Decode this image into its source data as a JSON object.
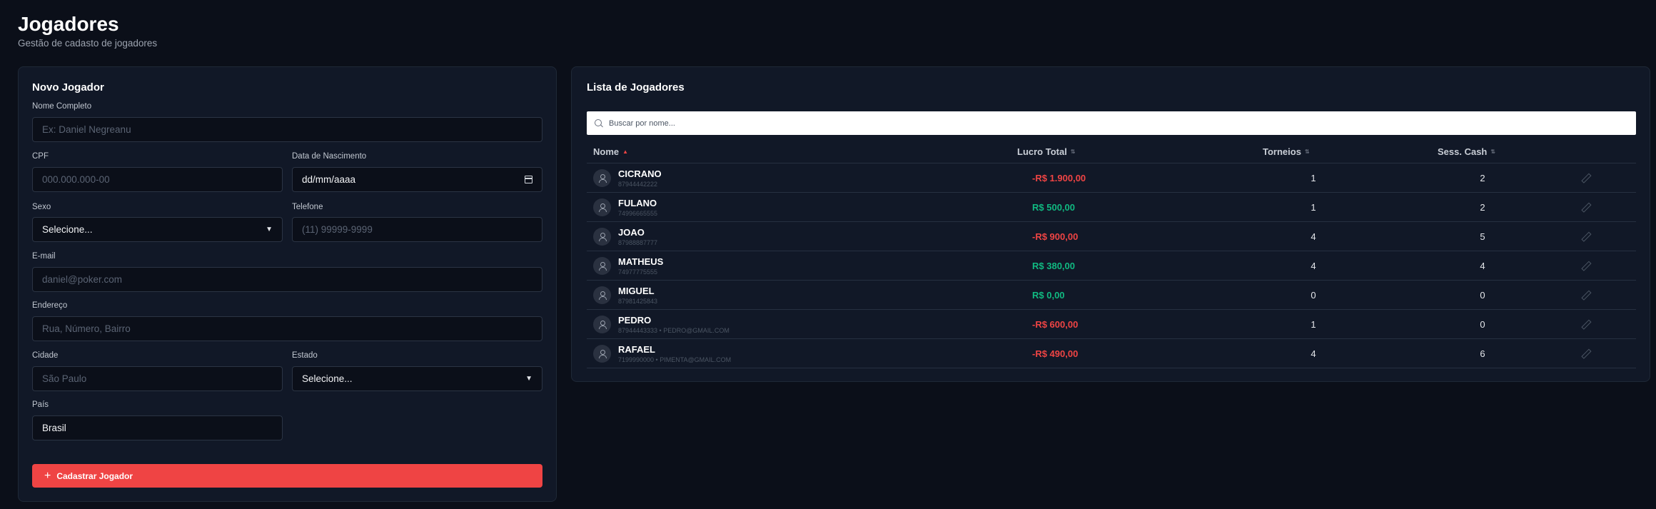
{
  "page": {
    "title": "Jogadores",
    "subtitle": "Gestão de cadasto de jogadores"
  },
  "form": {
    "title": "Novo Jogador",
    "fields": {
      "nome": {
        "label": "Nome Completo",
        "placeholder": "Ex: Daniel Negreanu",
        "value": ""
      },
      "cpf": {
        "label": "CPF",
        "placeholder": "000.000.000-00",
        "value": ""
      },
      "nascimento": {
        "label": "Data de Nascimento",
        "value": "dd/mm/aaaa"
      },
      "sexo": {
        "label": "Sexo",
        "value": "Selecione..."
      },
      "telefone": {
        "label": "Telefone",
        "placeholder": "(11) 99999-9999",
        "value": ""
      },
      "email": {
        "label": "E-mail",
        "placeholder": "daniel@poker.com",
        "value": ""
      },
      "endereco": {
        "label": "Endereço",
        "placeholder": "Rua, Número, Bairro",
        "value": ""
      },
      "cidade": {
        "label": "Cidade",
        "placeholder": "São Paulo",
        "value": ""
      },
      "estado": {
        "label": "Estado",
        "value": "Selecione..."
      },
      "pais": {
        "label": "País",
        "value": "Brasil"
      }
    },
    "submit_label": "Cadastrar Jogador",
    "icons": {
      "submit": "plus-icon",
      "date": "calendar-icon",
      "select": "chevron-down-icon"
    }
  },
  "list": {
    "title": "Lista de Jogadores",
    "search_placeholder": "Buscar por nome...",
    "columns": {
      "nome": "Nome",
      "lucro": "Lucro Total",
      "torneios": "Torneios",
      "cash": "Sess. Cash"
    },
    "sort": {
      "column": "Nome",
      "direction": "asc"
    },
    "rows": [
      {
        "name": "CICRANO",
        "sub": "87944442222",
        "profit": "-R$ 1.900,00",
        "profit_sign": "negative",
        "torneios": "1",
        "cash": "2"
      },
      {
        "name": "FULANO",
        "sub": "74996665555",
        "profit": "R$ 500,00",
        "profit_sign": "positive",
        "torneios": "1",
        "cash": "2"
      },
      {
        "name": "JOAO",
        "sub": "87988887777",
        "profit": "-R$ 900,00",
        "profit_sign": "negative",
        "torneios": "4",
        "cash": "5"
      },
      {
        "name": "MATHEUS",
        "sub": "74977775555",
        "profit": "R$ 380,00",
        "profit_sign": "positive",
        "torneios": "4",
        "cash": "4"
      },
      {
        "name": "MIGUEL",
        "sub": "87981425843",
        "profit": "R$ 0,00",
        "profit_sign": "positive",
        "torneios": "0",
        "cash": "0"
      },
      {
        "name": "PEDRO",
        "sub": "87944443333 • PEDRO@GMAIL.COM",
        "profit": "-R$ 600,00",
        "profit_sign": "negative",
        "torneios": "1",
        "cash": "0"
      },
      {
        "name": "RAFAEL",
        "sub": "7199990000 • PIMENTA@GMAIL.COM",
        "profit": "-R$ 490,00",
        "profit_sign": "negative",
        "torneios": "4",
        "cash": "6"
      }
    ],
    "icons": {
      "avatar": "user-icon",
      "action": "edit-icon",
      "search": "search-icon"
    }
  },
  "colors": {
    "background": "#0b0f19",
    "card": "#111827",
    "accent": "#ef4444",
    "positive": "#10b981",
    "negative": "#ef4444"
  }
}
